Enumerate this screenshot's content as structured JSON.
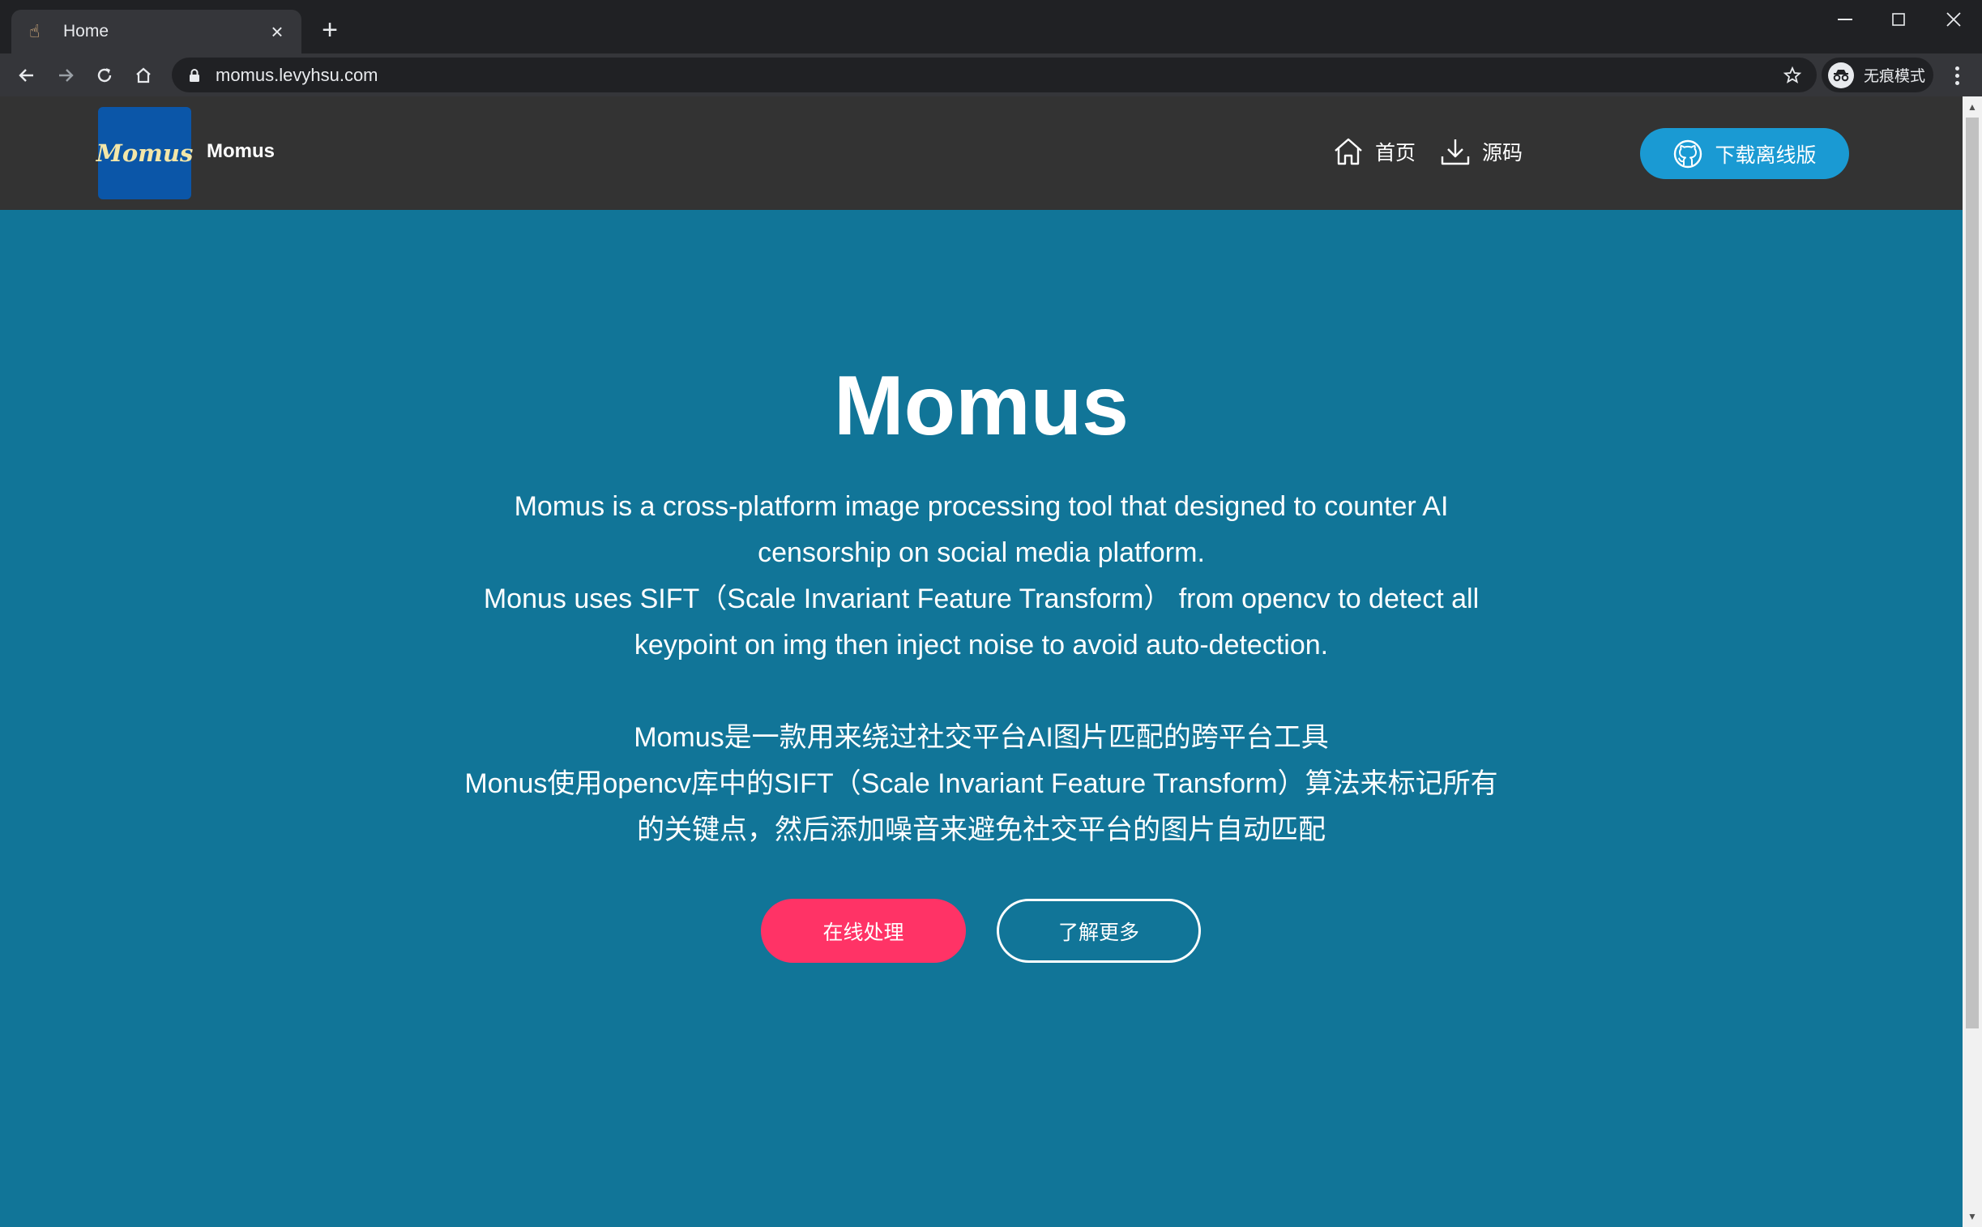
{
  "browser": {
    "tab_title": "Home",
    "tab_favicon": "pointing-hand-icon",
    "url": "momus.levyhsu.com",
    "incognito_label": "无痕模式"
  },
  "site": {
    "logo_text": "Momus",
    "brand": "Momus",
    "nav": [
      {
        "label": "首页",
        "icon": "home-icon"
      },
      {
        "label": "源码",
        "icon": "download-icon"
      }
    ],
    "download_button": "下载离线版"
  },
  "hero": {
    "title": "Momus",
    "desc_en_1": "Momus is a cross-platform image processing tool that designed to counter AI",
    "desc_en_2": "censorship on social media platform.",
    "desc_en_3": "Monus uses SIFT（Scale Invariant Feature Transform） from opencv to detect all",
    "desc_en_4": "keypoint on img then inject noise to avoid auto-detection.",
    "desc_zh_1": "Momus是一款用来绕过社交平台AI图片匹配的跨平台工具",
    "desc_zh_2": "Monus使用opencv库中的SIFT（Scale Invariant Feature Transform）算法来标记所有",
    "desc_zh_3": "的关键点，然后添加噪音来避免社交平台的图片自动匹配",
    "primary_button": "在线处理",
    "secondary_button": "了解更多"
  },
  "colors": {
    "hero_bg": "#117598",
    "header_bg": "#333333",
    "primary": "#ff3366",
    "download_btn": "#1a9ad3",
    "logo_bg": "#0b56a8"
  }
}
